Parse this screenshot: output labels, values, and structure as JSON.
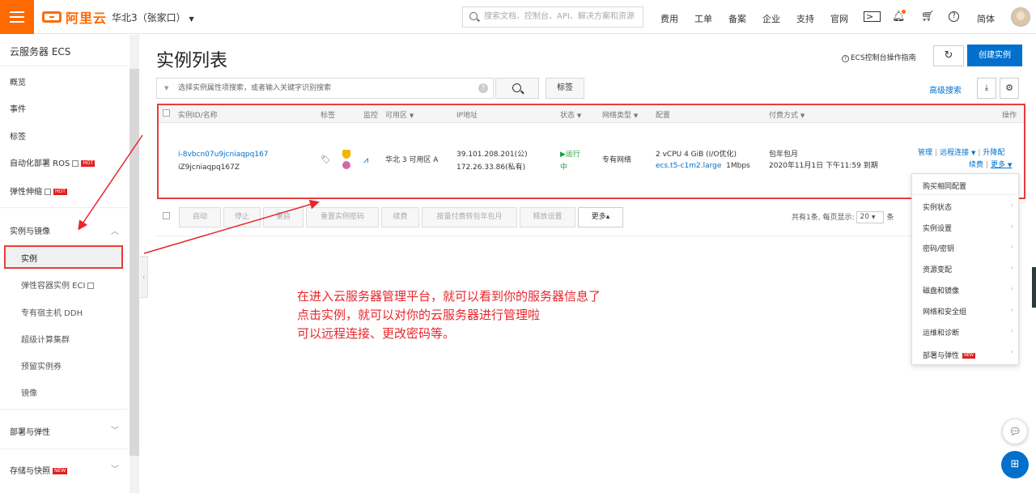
{
  "topbar": {
    "logo_text": "阿里云",
    "region": "华北3（张家口）",
    "search_placeholder": "搜索文档、控制台、API、解决方案和资源",
    "nav": [
      "费用",
      "工单",
      "备案",
      "企业",
      "支持",
      "官网"
    ],
    "language": "简体"
  },
  "sidebar": {
    "title": "云服务器 ECS",
    "items_top": [
      "概览",
      "事件",
      "标签",
      "自动化部署 ROS",
      "弹性伸缩"
    ],
    "hot_badge": "HOT",
    "group_instances": "实例与镜像",
    "sub_items": [
      "实例",
      "弹性容器实例 ECI",
      "专有宿主机 DDH",
      "超级计算集群",
      "预留实例券",
      "镜像"
    ],
    "group_deploy": "部署与弹性",
    "group_storage": "存储与快照",
    "new_badge": "NEW"
  },
  "main": {
    "title": "实例列表",
    "guide_link": "ECS控制台操作指南",
    "create_button": "创建实例",
    "filter_placeholder": "选择实例属性项搜索，或者输入关键字识别搜索",
    "tag_button": "标签",
    "advanced_search": "高级搜索"
  },
  "table": {
    "headers": {
      "id": "实例ID/名称",
      "tag": "标签",
      "monitor": "监控",
      "zone": "可用区",
      "ip": "IP地址",
      "status": "状态",
      "network": "网络类型",
      "config": "配置",
      "billing": "付费方式",
      "actions": "操作"
    },
    "row": {
      "id": "i-8vbcn07u9jcniaqpq167",
      "name": "iZ9jcniaqpq167Z",
      "zone": "华北 3 可用区 A",
      "public_ip": "39.101.208.201(公)",
      "private_ip": "172.26.33.86(私有)",
      "status_1": "运行",
      "status_2": "中",
      "network": "专有网络",
      "config_line1": "2 vCPU 4 GiB (I/O优化)",
      "config_type": "ecs.t5-c1m2.large",
      "config_bandwidth": "1Mbps",
      "billing_line1": "包年包月",
      "billing_line2": "2020年11月1日 下午11:59 到期",
      "action_manage": "管理",
      "action_remote": "远程连接",
      "action_upgrade": "升降配",
      "action_renew": "续费",
      "action_more": "更多"
    }
  },
  "toolbar": {
    "buttons": [
      "启动",
      "停止",
      "重启",
      "重置实例密码",
      "续费",
      "按量付费转包年包月",
      "释放设置"
    ],
    "more": "更多▴",
    "pagination_text": "共有1条, 每页显示:",
    "page_size": "20",
    "pagination_suffix": "条"
  },
  "dropdown": {
    "items": [
      "购买相同配置",
      "实例状态",
      "实例设置",
      "密码/密钥",
      "资源变配",
      "磁盘和镜像",
      "网络和安全组",
      "运维和诊断",
      "部署与弹性"
    ],
    "new_badge": "NEW"
  },
  "annotation": {
    "lines": [
      "在进入云服务器管理平台，就可以看到你的服务器信息了",
      "点击实例，就可以对你的云服务器进行管理啦",
      "可以远程连接、更改密码等。"
    ]
  },
  "colors": {
    "brand": "#ff6a00",
    "primary": "#0070cc",
    "annotation": "#e8262c",
    "running": "#1e9e3e"
  }
}
